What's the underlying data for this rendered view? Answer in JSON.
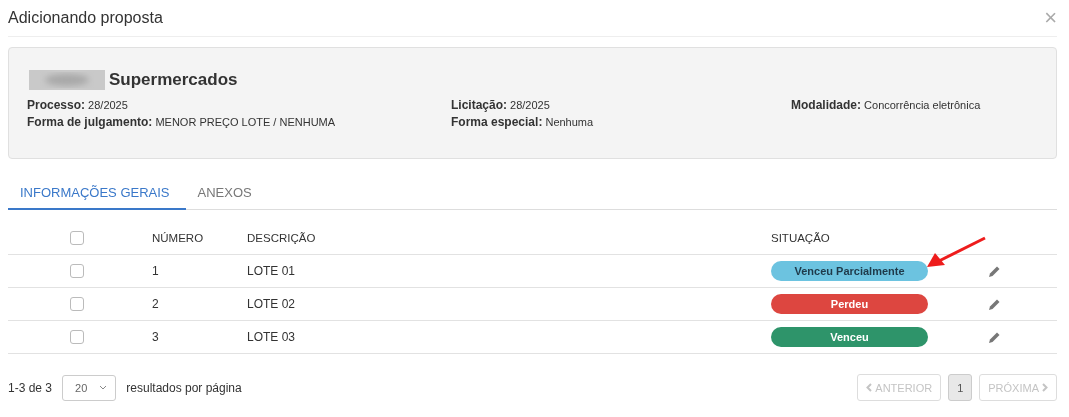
{
  "dialog": {
    "title": "Adicionando proposta",
    "close": "×"
  },
  "summary": {
    "name": "Supermercados",
    "fields": [
      {
        "label": "Processo:",
        "value": "28/2025"
      },
      {
        "label": "Licitação:",
        "value": "28/2025"
      },
      {
        "label": "Modalidade:",
        "value": "Concorrência eletrônica"
      },
      {
        "label": "Forma de julgamento:",
        "value": "MENOR PREÇO LOTE / NENHUMA"
      },
      {
        "label": "Forma especial:",
        "value": "Nenhuma"
      }
    ]
  },
  "tabs": [
    {
      "label": "INFORMAÇÕES GERAIS",
      "selected": true
    },
    {
      "label": "ANEXOS",
      "selected": false
    }
  ],
  "table": {
    "header_checked": false,
    "columns": [
      "NÚMERO",
      "DESCRIÇÃO",
      "SITUAÇÃO"
    ],
    "rows": [
      {
        "checked": false,
        "number": "1",
        "description": "LOTE 01",
        "status": "Venceu Parcialmente",
        "color": "#6cc3e0",
        "annotated": true
      },
      {
        "checked": false,
        "number": "2",
        "description": "LOTE 02",
        "status": "Perdeu",
        "color": "#dd4640",
        "annotated": false
      },
      {
        "checked": false,
        "number": "3",
        "description": "LOTE 03",
        "status": "Venceu",
        "color": "#2e946a",
        "annotated": false
      }
    ]
  },
  "footer": {
    "range": "1-3 de 3",
    "page_size": "20",
    "page_size_label": "resultados por página",
    "pages": [
      {
        "kind": "prev",
        "label": "ANTERIOR",
        "disabled": true,
        "selected": false
      },
      {
        "kind": "page",
        "label": "1",
        "disabled": false,
        "selected": true
      },
      {
        "kind": "next",
        "label": "PRÓXIMA",
        "disabled": true,
        "selected": false
      }
    ]
  }
}
